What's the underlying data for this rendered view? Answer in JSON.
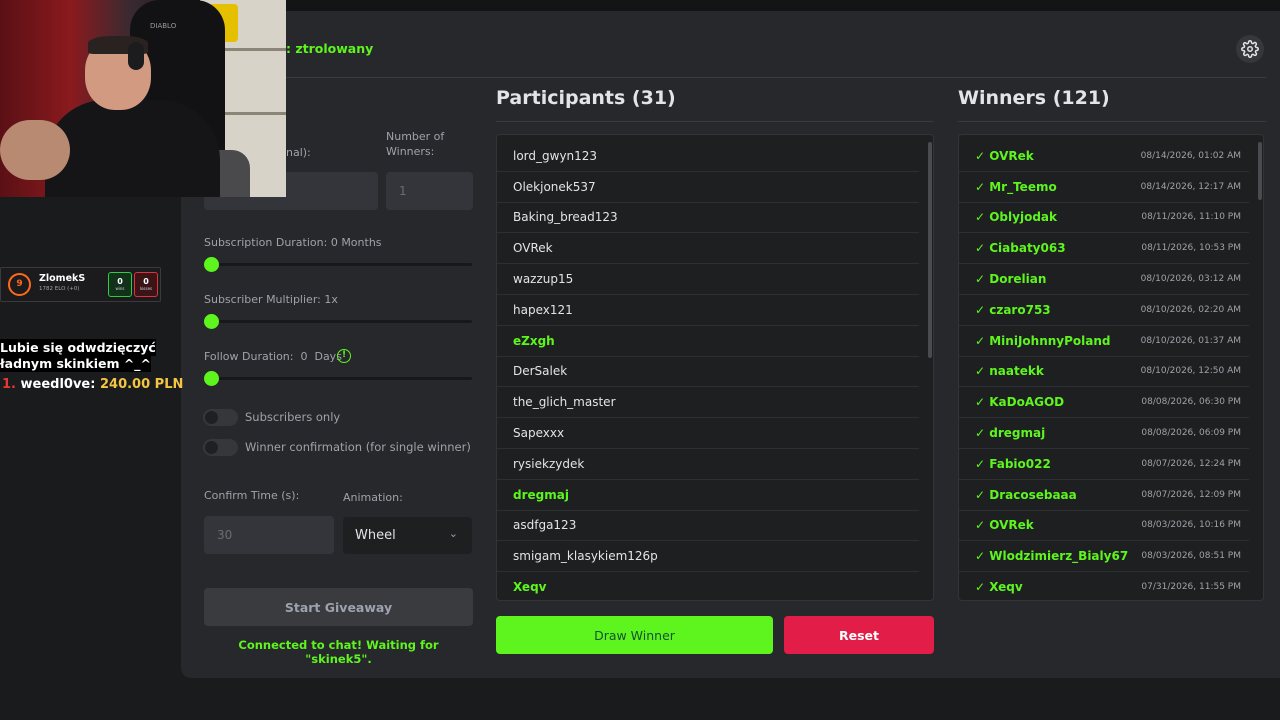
{
  "header": {
    "channel_label": ": ztrolowany",
    "settings_icon": "gear-icon"
  },
  "settings": {
    "label_partial": "nal):",
    "number_winners_label": "Number of Winners:",
    "number_winners_placeholder": "1",
    "subscription_duration_label": "Subscription Duration: 0 Months",
    "subscriber_multiplier_label": "Subscriber Multiplier: 1x",
    "follow_duration_label": "Follow Duration:  0  Days",
    "info_icon": "!",
    "subscribers_only_label": "Subscribers only",
    "winner_confirmation_label": "Winner confirmation (for single winner)",
    "confirm_time_label": "Confirm Time (s):",
    "confirm_time_placeholder": "30",
    "animation_label": "Animation:",
    "animation_value": "Wheel",
    "start_button": "Start Giveaway",
    "status_text": "Connected to chat! Waiting for \"skinek5\".",
    "accent_color": "#5ef51e"
  },
  "participants": {
    "title": "Participants (31)",
    "items": [
      {
        "name": "lord_gwyn123",
        "winner": false
      },
      {
        "name": "Olekjonek537",
        "winner": false
      },
      {
        "name": "Baking_bread123",
        "winner": false
      },
      {
        "name": "OVRek",
        "winner": false
      },
      {
        "name": "wazzup15",
        "winner": false
      },
      {
        "name": "hapex121",
        "winner": false
      },
      {
        "name": "eZxgh",
        "winner": true
      },
      {
        "name": "DerSalek",
        "winner": false
      },
      {
        "name": "the_glich_master",
        "winner": false
      },
      {
        "name": "Sapexxx",
        "winner": false
      },
      {
        "name": "rysiekzydek",
        "winner": false
      },
      {
        "name": "dregmaj",
        "winner": true
      },
      {
        "name": "asdfga123",
        "winner": false
      },
      {
        "name": "smigam_klasykiem126p",
        "winner": false
      },
      {
        "name": "Xeqv",
        "winner": true
      }
    ]
  },
  "winners": {
    "title": "Winners (121)",
    "items": [
      {
        "name": "✓ OVRek",
        "date": "08/14/2026, 01:02 AM"
      },
      {
        "name": "✓ Mr_Teemo",
        "date": "08/14/2026, 12:17 AM"
      },
      {
        "name": "✓ Oblyjodak",
        "date": "08/11/2026, 11:10 PM"
      },
      {
        "name": "✓ Ciabaty063",
        "date": "08/11/2026, 10:53 PM"
      },
      {
        "name": "✓ Dorelian",
        "date": "08/10/2026, 03:12 AM"
      },
      {
        "name": "✓ czaro753",
        "date": "08/10/2026, 02:20 AM"
      },
      {
        "name": "✓ MiniJohnnyPoland",
        "date": "08/10/2026, 01:37 AM"
      },
      {
        "name": "✓ naatekk",
        "date": "08/10/2026, 12:50 AM"
      },
      {
        "name": "✓ KaDoAGOD",
        "date": "08/08/2026, 06:30 PM"
      },
      {
        "name": "✓ dregmaj",
        "date": "08/08/2026, 06:09 PM"
      },
      {
        "name": "✓ Fabio022",
        "date": "08/07/2026, 12:24 PM"
      },
      {
        "name": "✓ Dracosebaaa",
        "date": "08/07/2026, 12:09 PM"
      },
      {
        "name": "✓ OVRek",
        "date": "08/03/2026, 10:16 PM"
      },
      {
        "name": "✓ Wlodzimierz_Bialy67",
        "date": "08/03/2026, 08:51 PM"
      },
      {
        "name": "✓ Xeqv",
        "date": "07/31/2026, 11:55 PM"
      }
    ]
  },
  "actions": {
    "draw_button": "Draw Winner",
    "reset_button": "Reset",
    "draw_color": "#5ef51e",
    "reset_color": "#e11d48"
  },
  "overlay": {
    "chair_logo": "DIABLO",
    "player": {
      "level": "9",
      "name": "ZlomekS",
      "elo": "1782 ELO (+0)",
      "wins": "0",
      "wins_label": "wins",
      "losses": "0",
      "losses_label": "losses"
    },
    "chat_line1": "Lubie się odwdzięczyć",
    "chat_line2": "ładnym skinkiem ^_^",
    "donation_rank": "1.",
    "donation_name": " weedl0ve: ",
    "donation_amount": "240.00 PLN"
  }
}
